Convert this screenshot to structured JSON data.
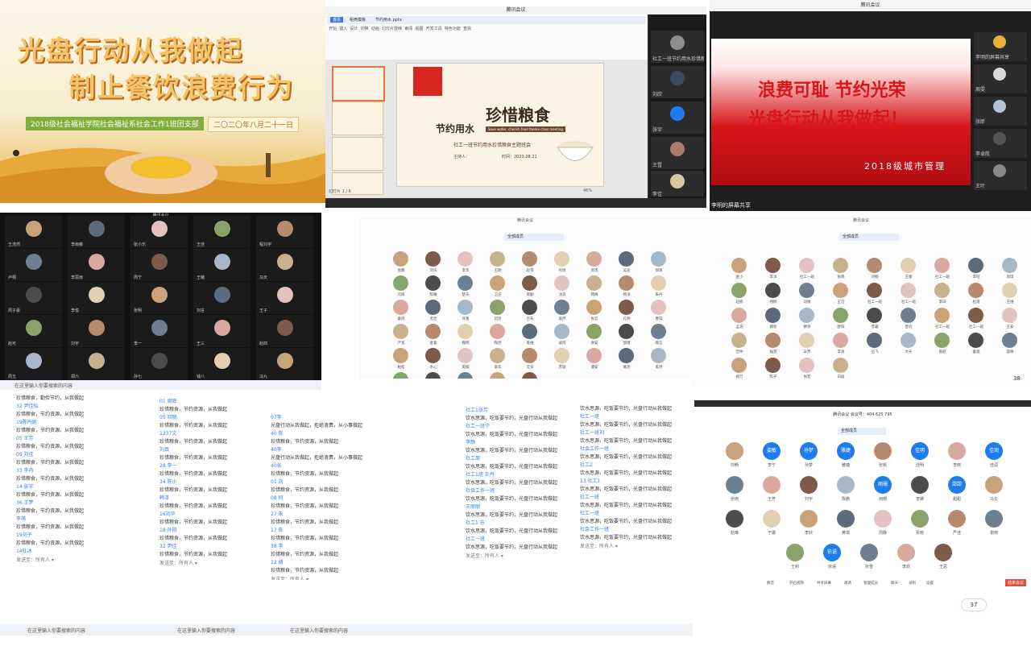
{
  "banner": {
    "line1": "光盘行动从我做起",
    "line2": "制止餐饮浪费行为",
    "org": "2018级社会福祉学院社会福祉系社会工作1班团支部",
    "date": "二〇二〇年八月二十一日"
  },
  "wps": {
    "window_title": "腾讯会议",
    "slide_title": "珍惜粮食",
    "slide_subtitle": "节约用水",
    "slide_en": "Save water, cherish food theme class meeting",
    "slide_meeting": "社工一班节约用水珍惜粮食主题班会",
    "host_label": "主持人：",
    "date_label": "时间：2020.08.21",
    "tabs": [
      "首页",
      "稻壳模板",
      "节约用水.pptx"
    ],
    "menus": [
      "开始",
      "插入",
      "设计",
      "切换",
      "动画",
      "幻灯片放映",
      "审阅",
      "视图",
      "开发工具",
      "特色功能",
      "查找"
    ],
    "slide_count": "幻灯片 1 / 6",
    "zoom": "46%",
    "participants": [
      {
        "name": "社工一班节约用水珍惜粮食主题班会"
      },
      {
        "name": "刘欣"
      },
      {
        "name": "张宇"
      },
      {
        "name": "王雪"
      },
      {
        "name": "李佳"
      }
    ]
  },
  "tencent": {
    "window_title": "腾讯会议",
    "line1": "浪费可耻  节约光荣",
    "line2": "光盘行动从我做起！",
    "caption": "2018级城市管理",
    "footer": "李明的屏幕共享",
    "side": [
      "李明的屏幕共享",
      "周雯",
      "张昕",
      "李卓航",
      "王叶"
    ]
  },
  "darkgrid": {
    "title": "腾讯会议",
    "names": [
      "王浩然",
      "李雨薇",
      "张小乐",
      "王佳",
      "程刘宇",
      "卢桐",
      "李思雨",
      "周宁",
      "王曦",
      "马天",
      "周子豪",
      "李悦",
      "张明",
      "刘言",
      "王子",
      "赵可",
      "刘宇",
      "李一",
      "王三",
      "赵四",
      "周五",
      "郑六",
      "孙七",
      "钱八",
      "冯九",
      "陈十",
      "杨帆",
      "吴迪",
      "郭鹏",
      "何静"
    ],
    "taskbar_search": "在这里输入你要搜索的内容"
  },
  "grid5": {
    "title": "腾讯会议",
    "tab": "全部成员",
    "names": [
      "张鹏",
      "刘乐",
      "李华",
      "王明",
      "赵雪",
      "孙悦",
      "周杰",
      "吴迪",
      "郑爽",
      "冯雨",
      "陈曦",
      "楚天",
      "卫庄",
      "蒋勤",
      "沈浪",
      "韩梅",
      "杨洋",
      "朱丹",
      "秦风",
      "尤佳",
      "许嵩",
      "何炅",
      "吕布",
      "施然",
      "张云",
      "孔明",
      "曹操",
      "严宽",
      "金喜",
      "魏明",
      "陶然",
      "姜维",
      "戚风",
      "谢安",
      "邹瑾",
      "喻言",
      "柏松",
      "水心",
      "窦娟",
      "章华",
      "云朵",
      "苏轼",
      "潘安",
      "葛优",
      "奚然",
      "范冰",
      "彭于",
      "郎朗",
      "鲁迅",
      "韦博"
    ]
  },
  "grid6": {
    "title": "腾讯会议",
    "tab": "全部成员",
    "count": "38",
    "names": [
      "金小",
      "李洋",
      "社工一班",
      "张晓",
      "刘畅",
      "王蒙",
      "社工一班",
      "李钰",
      "周琪",
      "赵楠",
      "杨柳",
      "刘婧",
      "王洁",
      "社工一班",
      "社工一班",
      "李白",
      "杜甫",
      "王维",
      "孟浩",
      "韩愈",
      "柳宗",
      "欧阳",
      "苏辙",
      "曾巩",
      "社工一班",
      "社工一班",
      "王安",
      "范仲",
      "陆游",
      "辛弃",
      "李清",
      "岳飞",
      "文天",
      "黄庭",
      "秦观",
      "晏殊",
      "杨万",
      "陈子",
      "张若",
      "白居"
    ]
  },
  "chat1": {
    "lines": [
      [
        "",
        "珍惜粮食，勤俭节约，从我做起"
      ],
      [
        "32 尹佳怡",
        ""
      ],
      [
        "",
        "珍惜粮食，节约资源，从我做起"
      ],
      [
        "19陈丹妮",
        ""
      ],
      [
        "",
        "珍惜粮食，节约资源，从我做起"
      ],
      [
        "05 王芳",
        ""
      ],
      [
        "",
        "珍惜粮食，节约资源，从我做起"
      ],
      [
        "09 刘佳",
        ""
      ],
      [
        "",
        "珍惜粮食，节约资源，从我做起"
      ],
      [
        "33 李冉",
        ""
      ],
      [
        "",
        "珍惜粮食，节约资源，从我做起"
      ],
      [
        "14 张宇",
        ""
      ],
      [
        "",
        "珍惜粮食，节约资源，从我做起"
      ],
      [
        "36 王梦",
        ""
      ],
      [
        "",
        "珍惜粮食，节约资源，从我做起"
      ],
      [
        "李萌",
        ""
      ],
      [
        "",
        "珍惜粮食，节约资源，从我做起"
      ],
      [
        "19刘子",
        ""
      ],
      [
        "",
        "珍惜粮食，节约资源，从我做起"
      ],
      [
        "14杜冰",
        ""
      ]
    ],
    "send_to": "发送至：所有人 ▾",
    "search": "在这里输入你要搜索的内容"
  },
  "chat2": {
    "lines": [
      [
        "01 周辉",
        ""
      ],
      [
        "",
        "珍惜粮食，节约资源，从我做起"
      ],
      [
        "05 邓丽",
        ""
      ],
      [
        "",
        "珍惜粮食，节约资源，从我做起"
      ],
      [
        "1237文",
        ""
      ],
      [
        "",
        "珍惜粮食，节约资源，从我做起"
      ],
      [
        "刘真",
        ""
      ],
      [
        "",
        "珍惜粮食，节约资源，从我做起"
      ],
      [
        "28 李一",
        ""
      ],
      [
        "",
        "珍惜粮食，节约资源，从我做起"
      ],
      [
        "34 陈小",
        ""
      ],
      [
        "",
        "珍惜粮食，节约资源，从我做起"
      ],
      [
        "韩泽",
        ""
      ],
      [
        "",
        "珍惜粮食，节约资源，从我做起"
      ],
      [
        "16刘华",
        ""
      ],
      [
        "",
        "珍惜粮食，节约资源，从我做起"
      ],
      [
        "18 孙阳",
        ""
      ],
      [
        "",
        "珍惜粮食，节约资源，从我做起"
      ],
      [
        "32 尹佳",
        ""
      ],
      [
        "",
        "珍惜粮食，节约资源，从我做起"
      ]
    ],
    "send_to": "发送至：所有人 ▾",
    "search": "在这里输入你要搜索的内容"
  },
  "chat3": {
    "lines": [
      [
        "07李",
        ""
      ],
      [
        "",
        "光盘行动从我做起，拒绝浪费，从小事做起"
      ],
      [
        "40 陈",
        ""
      ],
      [
        "",
        "珍惜粮食，节约资源，从我做起"
      ],
      [
        "40李",
        ""
      ],
      [
        "",
        "光盘行动从我做起，拒绝浪费，从小事做起"
      ],
      [
        "40张",
        ""
      ],
      [
        "",
        "珍惜粮食，节约资源，从我做起"
      ],
      [
        "01 刘",
        ""
      ],
      [
        "",
        "珍惜粮食，节约资源，从我做起"
      ],
      [
        "08 何",
        ""
      ],
      [
        "",
        "珍惜粮食，节约资源，从我做起"
      ],
      [
        "27 朱",
        ""
      ],
      [
        "",
        "珍惜粮食，节约资源，从我做起"
      ],
      [
        "17 陈",
        ""
      ],
      [
        "",
        "珍惜粮食，节约资源，从我做起"
      ],
      [
        "38 李",
        ""
      ],
      [
        "",
        "珍惜粮食，节约资源，从我做起"
      ],
      [
        "12 胡",
        ""
      ],
      [
        "",
        "珍惜粮食，节约资源，从我做起"
      ]
    ],
    "send_to": "发送至：所有人 ▾",
    "search": "在这里输入你要搜索的内容"
  },
  "chat4": {
    "lines": [
      [
        "社工1张芳",
        ""
      ],
      [
        "",
        "饮水思源，吃饭要节约，光盘行动从我做起"
      ],
      [
        "社工一班宁",
        ""
      ],
      [
        "",
        "饮水思源，吃饭要节约，光盘行动从我做起"
      ],
      [
        "李静",
        ""
      ],
      [
        "",
        "饮水思源，吃饭要节约，光盘行动从我做起"
      ],
      [
        "社工周",
        ""
      ],
      [
        "",
        "饮水思源，吃饭要节约，光盘行动从我做起"
      ],
      [
        "社工1班 王丹",
        ""
      ],
      [
        "",
        "饮水思源，吃饭要节约，光盘行动从我做起"
      ],
      [
        "社会工作一班",
        ""
      ],
      [
        "",
        "饮水思源，吃饭要节约，光盘行动从我做起"
      ],
      [
        "王丽丽",
        ""
      ],
      [
        "",
        "饮水思源，吃饭要节约，光盘行动从我做起"
      ],
      [
        "社工1 苏",
        ""
      ],
      [
        "",
        "饮水思源，吃饭要节约，光盘行动从我做起"
      ],
      [
        "社工一班",
        ""
      ],
      [
        "",
        "饮水思源，吃饭要节约，光盘行动从我做起"
      ]
    ],
    "send_to": "发送至：所有人 ▾"
  },
  "chat5": {
    "lines": [
      [
        "",
        "饮水思源，吃饭要节约，光盘行动从我做起"
      ],
      [
        "社工一班",
        ""
      ],
      [
        "",
        "饮水思源，吃饭要节约，光盘行动从我做起"
      ],
      [
        "社工一班刘",
        ""
      ],
      [
        "",
        "饮水思源，吃饭要节约，光盘行动从我做起"
      ],
      [
        "社会工作一班",
        ""
      ],
      [
        "",
        "饮水思源，吃饭要节约，光盘行动从我做起"
      ],
      [
        "社工2",
        ""
      ],
      [
        "",
        "饮水思源，吃饭要节约，光盘行动从我做起"
      ],
      [
        "13 社工1",
        ""
      ],
      [
        "",
        "饮水思源，吃饭要节约，光盘行动从我做起"
      ],
      [
        "社工一班",
        ""
      ],
      [
        "",
        "饮水思源，吃饭要节约，光盘行动从我做起"
      ],
      [
        "社工一班",
        ""
      ],
      [
        "",
        "饮水思源，吃饭要节约，光盘行动从我做起"
      ],
      [
        "社会工作一班",
        ""
      ],
      [
        "",
        "饮水思源，吃饭要节约，光盘行动从我做起"
      ]
    ],
    "send_to": "发送至：所有人 ▾"
  },
  "wemeet": {
    "title": "腾讯会议 会议号：404 625 795",
    "tab": "全部成员",
    "count": "37",
    "names_row1": [
      "刘畅",
      "李宁",
      "孙梦",
      "雅婕",
      "张帆",
      "佳明",
      "李晓",
      "佳润"
    ],
    "blue_row1": [
      "",
      "姿敏",
      "孙梦",
      "雅婕",
      "",
      "佳明",
      "",
      "佳润"
    ],
    "names_row2": [
      "张雨",
      "王芳",
      "刘宇",
      "陈鹏",
      "雨珊",
      "李娜",
      "甜甜",
      "马云"
    ],
    "blue_row2": [
      "",
      "",
      "",
      "",
      "雨珊",
      "",
      "甜甜",
      ""
    ],
    "names_row3": [
      "赵琳",
      "于娜",
      "李欣",
      "黄琪",
      "周静",
      "贾晓",
      "严佳",
      "谢雨"
    ],
    "names_row4": [
      "王莉",
      "依语",
      "张雪",
      "李欢",
      "王思"
    ],
    "blue_row4": [
      "",
      "依语",
      "",
      "",
      ""
    ],
    "toolbar": [
      "静音",
      "开启视频",
      "共享屏幕",
      "邀请",
      "管理成员",
      "聊天",
      "录制",
      "设置"
    ],
    "end": "结束会议"
  },
  "colors": {
    "accent_blue": "#1d7df0",
    "banner_red": "#d6161b",
    "green": "#7fae3a"
  }
}
